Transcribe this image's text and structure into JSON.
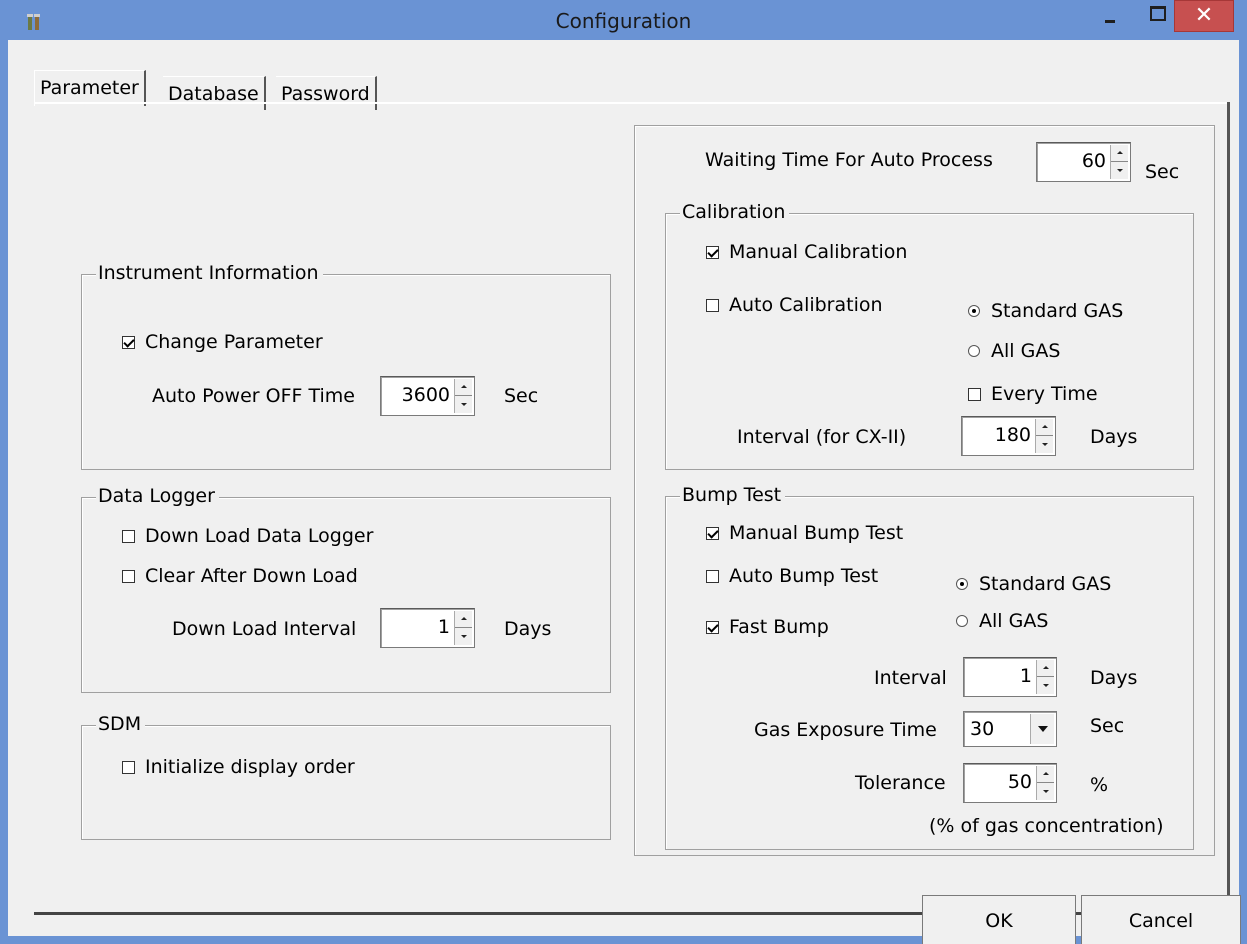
{
  "window": {
    "title": "Configuration",
    "close_symbol": "✕"
  },
  "tabs": [
    {
      "label": "Parameter",
      "active": true
    },
    {
      "label": "Database",
      "active": false
    },
    {
      "label": "Password",
      "active": false
    }
  ],
  "instrument_information": {
    "title": "Instrument Information",
    "change_parameter": {
      "label": "Change Parameter",
      "checked": true
    },
    "auto_power_off_label": "Auto Power OFF Time",
    "auto_power_off_value": "3600",
    "auto_power_off_unit": "Sec"
  },
  "data_logger": {
    "title": "Data Logger",
    "download": {
      "label": "Down Load Data Logger",
      "checked": false
    },
    "clear_after": {
      "label": "Clear After Down Load",
      "checked": false
    },
    "interval_label": "Down Load Interval",
    "interval_value": "1",
    "interval_unit": "Days"
  },
  "sdm": {
    "title": "SDM",
    "initialize": {
      "label": "Initialize display order",
      "checked": false
    }
  },
  "auto_process": {
    "label": "Waiting Time For Auto Process",
    "value": "60",
    "unit": "Sec"
  },
  "calibration": {
    "title": "Calibration",
    "manual": {
      "label": "Manual Calibration",
      "checked": true
    },
    "auto": {
      "label": "Auto Calibration",
      "checked": false
    },
    "standard_gas": {
      "label": "Standard GAS",
      "selected": true
    },
    "all_gas": {
      "label": "All GAS",
      "selected": false
    },
    "every_time": {
      "label": "Every Time",
      "checked": false
    },
    "interval_label": "Interval (for CX-II)",
    "interval_value": "180",
    "interval_unit": "Days"
  },
  "bump_test": {
    "title": "Bump Test",
    "manual": {
      "label": "Manual Bump Test",
      "checked": true
    },
    "auto": {
      "label": "Auto Bump Test",
      "checked": false
    },
    "fast": {
      "label": "Fast Bump",
      "checked": true
    },
    "standard_gas": {
      "label": "Standard GAS",
      "selected": true
    },
    "all_gas": {
      "label": "All GAS",
      "selected": false
    },
    "interval_label": "Interval",
    "interval_value": "1",
    "interval_unit": "Days",
    "exposure_label": "Gas Exposure Time",
    "exposure_value": "30",
    "exposure_unit": "Sec",
    "tolerance_label": "Tolerance",
    "tolerance_value": "50",
    "tolerance_unit": "%",
    "tolerance_note": "(% of gas concentration)"
  },
  "buttons": {
    "ok": "OK",
    "cancel": "Cancel"
  }
}
